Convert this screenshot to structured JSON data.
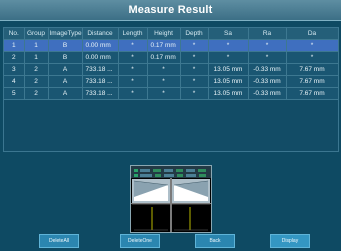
{
  "header": {
    "title": "Measure Result"
  },
  "table": {
    "columns": [
      "No.",
      "Group",
      "ImageType",
      "Distance",
      "Length",
      "Height",
      "Depth",
      "Sa",
      "Ra",
      "Da"
    ],
    "rows": [
      [
        "1",
        "1",
        "B",
        "0.00 mm",
        "*",
        "0.17 mm",
        "*",
        "*",
        "*",
        "*"
      ],
      [
        "2",
        "1",
        "B",
        "0.00 mm",
        "*",
        "0.17 mm",
        "*",
        "*",
        "*",
        "*"
      ],
      [
        "3",
        "2",
        "A",
        "733.18 ...",
        "*",
        "*",
        "*",
        "13.05 mm",
        "-0.33 mm",
        "7.67 mm"
      ],
      [
        "4",
        "2",
        "A",
        "733.18 ...",
        "*",
        "*",
        "*",
        "13.05 mm",
        "-0.33 mm",
        "7.67 mm"
      ],
      [
        "5",
        "2",
        "A",
        "733.18 ...",
        "*",
        "*",
        "*",
        "13.05 mm",
        "-0.33 mm",
        "7.67 mm"
      ]
    ]
  },
  "buttons": {
    "delete_all": "DeleteAll",
    "delete_one": "DeleteOne",
    "back": "Back",
    "display": "Display"
  }
}
